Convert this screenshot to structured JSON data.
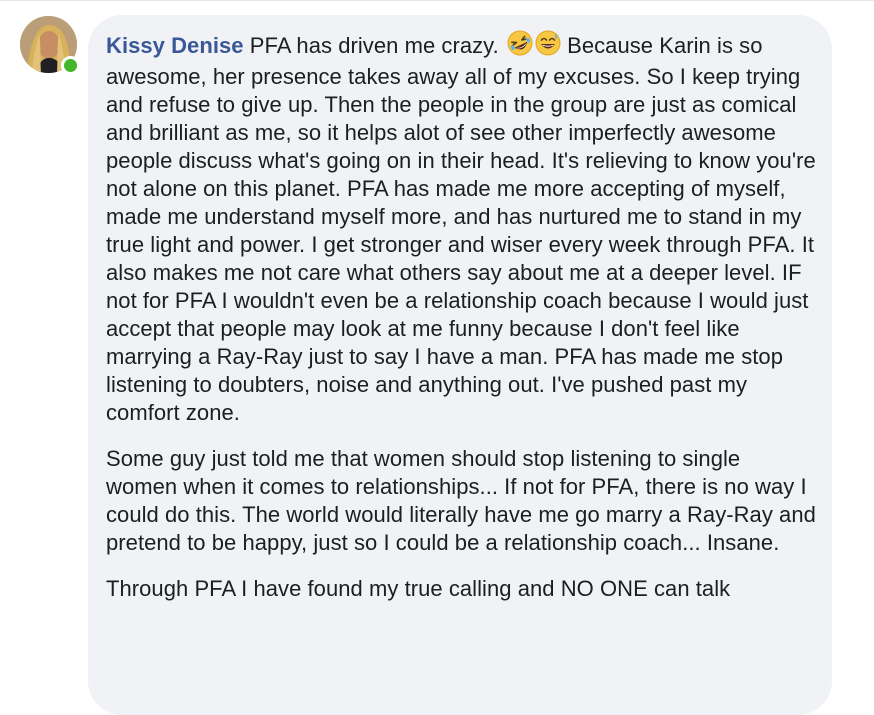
{
  "comment": {
    "author": "Kissy Denise",
    "online": true,
    "paragraph_1_intro": "PFA has driven me crazy.",
    "emojis": [
      "rolling-on-floor-laughing-emoji",
      "grinning-sweat-emoji"
    ],
    "paragraph_1_body": "Because Karin is so awesome, her presence takes away all of my excuses. So I keep trying and refuse to give up. Then the people in the group are just as comical and brilliant as me, so it helps alot of see other imperfectly awesome people discuss what's going on in their head. It's relieving to know you're not alone on this planet. PFA has made me more accepting of myself, made me understand myself more, and has nurtured me to stand in my true light and power. I get stronger and wiser every week through PFA. It also makes me not care what others say about me at a deeper level. IF not for PFA I wouldn't even be a relationship coach because I would just accept that people may look at me funny because I don't feel like marrying a Ray-Ray just to say I have a man. PFA has made me stop listening to doubters, noise and anything out. I've pushed past my comfort zone.",
    "paragraph_2": "Some guy just told me that women should stop listening to single women when it comes to relationships... If not for PFA, there is no way I could do this. The world would literally have me go marry a Ray-Ray and pretend to be happy, just so I could be a relationship coach... Insane.",
    "paragraph_3": "Through PFA I have found my true calling and NO ONE can talk"
  },
  "colors": {
    "author_link": "#385898",
    "bubble_bg": "#f0f2f5",
    "text": "#1c1e21",
    "online": "#42b72a"
  }
}
